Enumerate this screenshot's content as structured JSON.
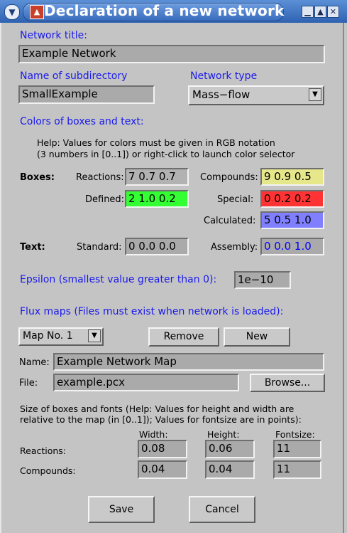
{
  "window": {
    "title": "Declaration of a new network"
  },
  "network_title": {
    "label": "Network title:",
    "value": "Example Network"
  },
  "subdir": {
    "label": "Name of subdirectory",
    "value": "SmallExample"
  },
  "network_type": {
    "label": "Network type",
    "value": "Mass−flow"
  },
  "colors": {
    "heading": "Colors of boxes and text:",
    "help_line1": "Help: Values for colors must be given in RGB notation",
    "help_line2": "(3 numbers in [0..1]) or right-click to launch color selector",
    "boxes_label": "Boxes:",
    "text_label": "Text:",
    "reactions": {
      "label": "Reactions:",
      "value": "7 0.7 0.7",
      "bg": "#b2b2b2"
    },
    "compounds": {
      "label": "Compounds:",
      "value": "9 0.9 0.5",
      "bg": "#e6e68a"
    },
    "defined": {
      "label": "Defined:",
      "value": "2 1.0 0.2",
      "bg": "#33ff33"
    },
    "special": {
      "label": "Special:",
      "value": "0 0.2 0.2",
      "bg": "#ff3333"
    },
    "calculated": {
      "label": "Calculated:",
      "value": "5 0.5 1.0",
      "bg": "#8080ff"
    },
    "standard": {
      "label": "Standard:",
      "value": "0 0.0 0.0",
      "color": "#000000"
    },
    "assembly": {
      "label": "Assembly:",
      "value": "0 0.0 1.0",
      "color": "#0000ff"
    }
  },
  "epsilon": {
    "label": "Epsilon (smallest value greater than 0):",
    "value": "1e−10"
  },
  "flux_maps": {
    "heading": "Flux maps (Files must exist when network is loaded):",
    "selected_map": "Map No. 1",
    "remove_label": "Remove",
    "new_label": "New",
    "name_label": "Name:",
    "name_value": "Example Network Map",
    "file_label": "File:",
    "file_value": "example.pcx",
    "browse_label": "Browse..."
  },
  "sizes": {
    "help_line1": "Size of boxes and fonts (Help: Values for height and width are",
    "help_line2": "relative to the map (in [0..1]); Values for fontsize are in points):",
    "col_width": "Width:",
    "col_height": "Height:",
    "col_fontsize": "Fontsize:",
    "reactions_label": "Reactions:",
    "compounds_label": "Compounds:",
    "reactions": {
      "width": "0.08",
      "height": "0.06",
      "fontsize": "11"
    },
    "compounds": {
      "width": "0.04",
      "height": "0.04",
      "fontsize": "11"
    }
  },
  "buttons": {
    "save": "Save",
    "cancel": "Cancel"
  },
  "icons": {
    "menu": "chevron-down-icon",
    "app": "app-logo-icon",
    "minimize": "minimize-icon",
    "maximize": "maximize-icon",
    "close": "close-icon"
  }
}
